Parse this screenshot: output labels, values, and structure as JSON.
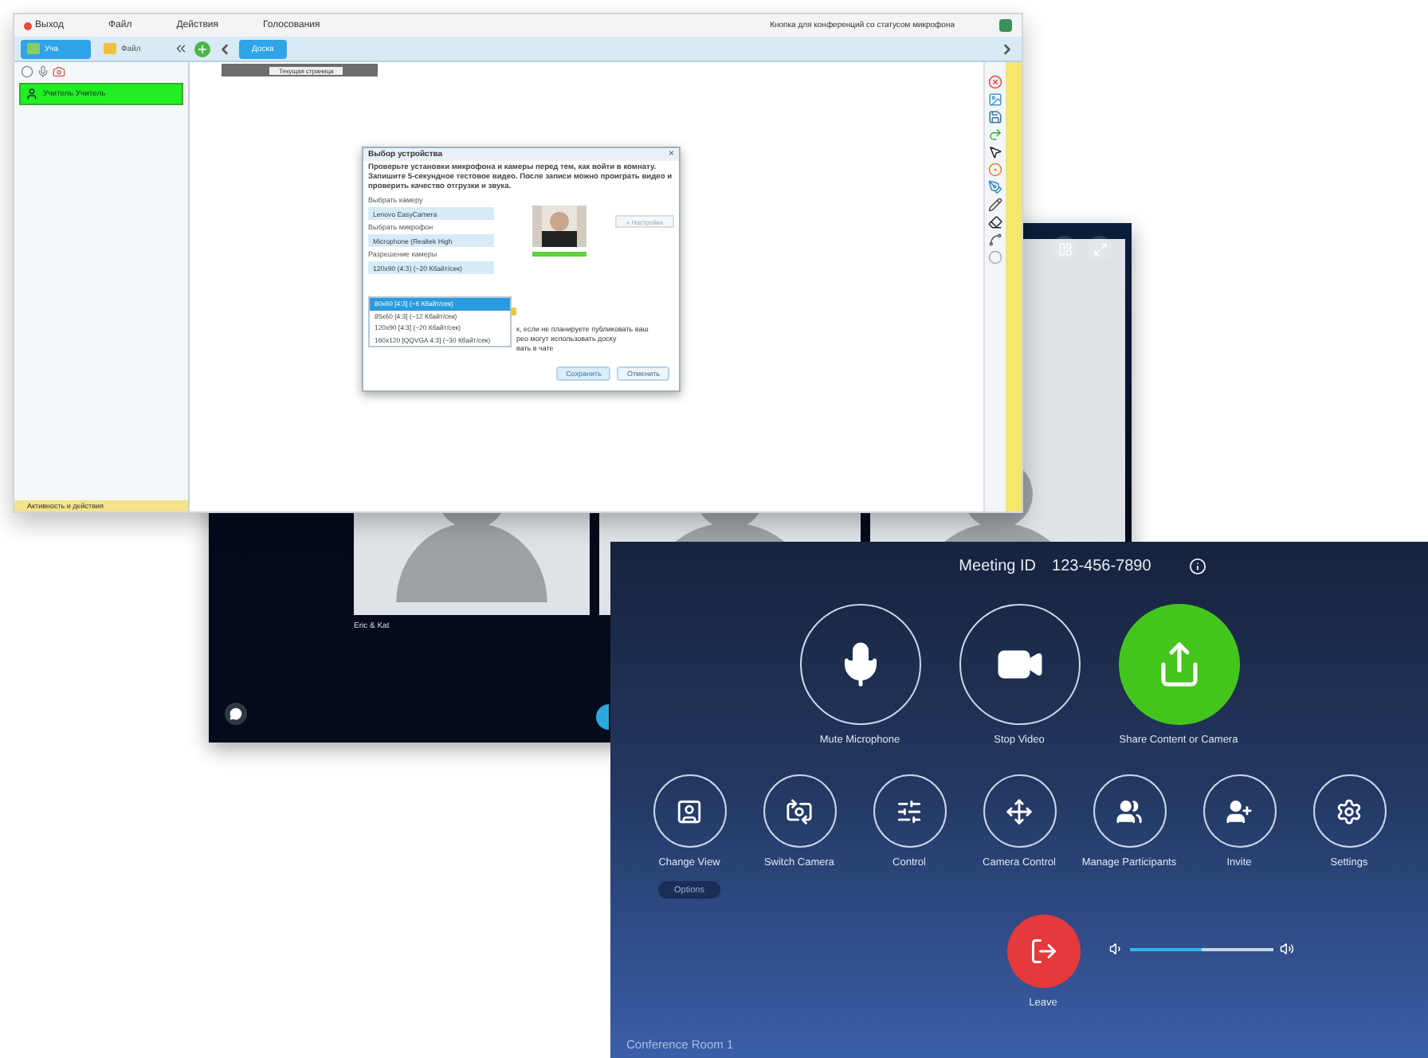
{
  "lesson_window": {
    "menu": [
      {
        "label": "Выход",
        "kind": "exit"
      },
      {
        "label": "Файл",
        "kind": "menu"
      },
      {
        "label": "Действия",
        "kind": "menu"
      },
      {
        "label": "Голосования",
        "kind": "menu"
      }
    ],
    "mic_hint": "Кнопка для конференций со статусом микрофона",
    "side_tabs": [
      {
        "label": "Уча",
        "selected": true
      },
      {
        "label": "Файл",
        "selected": false
      }
    ],
    "board_tabs": [
      {
        "label": "Доска",
        "selected": true
      }
    ],
    "page_select": "Текущая страница",
    "participants": [
      {
        "name": "Учитель Учитель",
        "selected": true
      }
    ],
    "activity": "Активность и действия",
    "dialog": {
      "title": "Выбор устройства",
      "close": "×",
      "intro": "Проверьте установки микрофона и камеры перед тем, как войти в комнату. Запишите 5-секундное тестовое видео. После записи можно проиграть видео и проверить качество отгрузки и звука.",
      "camera_label": "Выбрать камеру",
      "camera_value": "Lenovo EasyCamera",
      "mic_label": "Выбрать микрофон",
      "mic_value": "Microphone (Realtek High",
      "mic_meter": {
        "level": 1
      },
      "resolution_label": "Разрешение камеры",
      "resolution_value": "120x90 (4:3) (~20 Кбайт/сек)",
      "resolution_options": [
        {
          "label": "80x60 [4:3] (~6 Кбайт/сек)",
          "selected": true
        },
        {
          "label": "85x60 [4:3] (~12 Кбайт/сек)",
          "selected": false
        },
        {
          "label": "120x90 [4:3] (~20 Кбайт/сек)",
          "selected": false
        },
        {
          "label": "160x120 [QQVGA 4:3] (~30 Кбайт/сек)",
          "selected": false
        }
      ],
      "settings_button": "» Настройки",
      "note_lines": [
        "к, если не планируете публиковать ваш",
        "рео могут использовать доску",
        "вать в чате"
      ],
      "buttons": [
        {
          "label": "Сохранить",
          "kind": "save"
        },
        {
          "label": "Отменить",
          "kind": "cancel"
        }
      ]
    }
  },
  "video_window": {
    "tile_label": "Eric & Kat"
  },
  "room_controls": {
    "meeting_id_label": "Meeting ID",
    "meeting_id": "123-456-7890",
    "main_actions": [
      {
        "label": "Mute Microphone",
        "kind": "mic",
        "active": false
      },
      {
        "label": "Stop Video",
        "kind": "video",
        "active": false
      },
      {
        "label": "Share Content or Camera",
        "kind": "share",
        "active": true
      }
    ],
    "actions": [
      {
        "label": "Change View",
        "kind": "view"
      },
      {
        "label": "Switch Camera",
        "kind": "switch"
      },
      {
        "label": "Control",
        "kind": "control"
      },
      {
        "label": "Camera Control",
        "kind": "camera"
      },
      {
        "label": "Manage Participants",
        "kind": "participants"
      },
      {
        "label": "Invite",
        "kind": "invite"
      },
      {
        "label": "Settings",
        "kind": "settings"
      }
    ],
    "options": "Options",
    "leave": "Leave",
    "volume": {
      "level": 0.5
    },
    "room_name": "Conference Room 1"
  }
}
